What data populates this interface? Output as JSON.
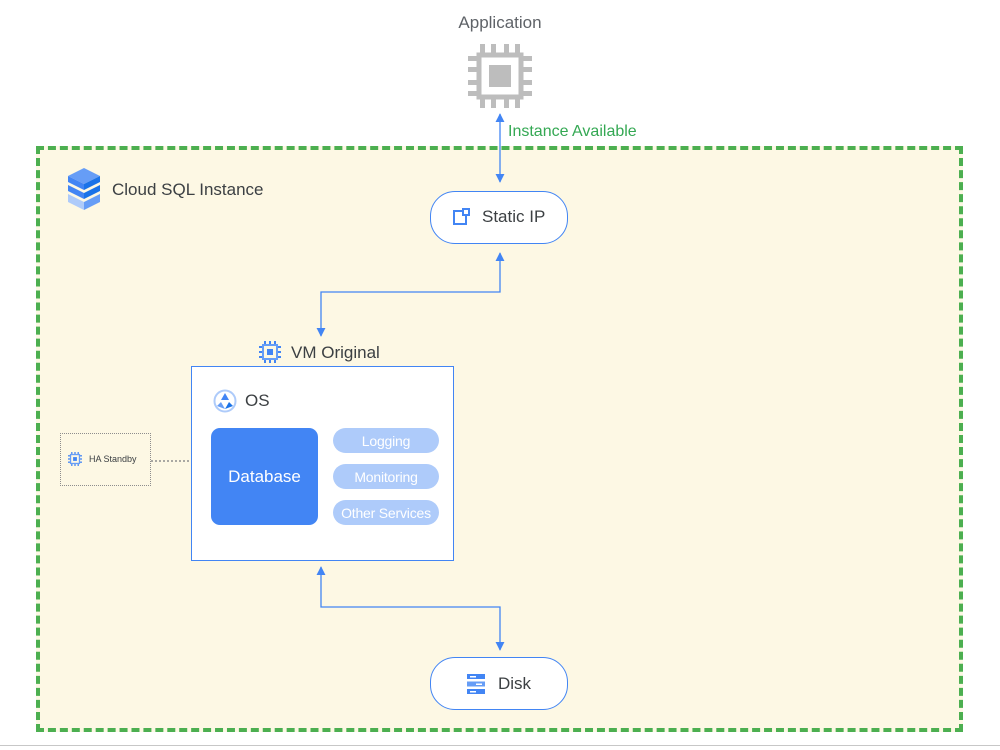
{
  "application": {
    "title": "Application"
  },
  "connection": {
    "label": "Instance Available"
  },
  "cloud_sql": {
    "title": "Cloud SQL Instance"
  },
  "static_ip": {
    "label": "Static IP"
  },
  "vm": {
    "title": "VM Original",
    "os_label": "OS",
    "database_label": "Database",
    "services": [
      "Logging",
      "Monitoring",
      "Other Services"
    ]
  },
  "ha_standby": {
    "label": "HA Standby"
  },
  "disk": {
    "label": "Disk"
  },
  "colors": {
    "accent": "#4285f4",
    "service_pill": "#aecbfa",
    "region_fill": "#fdf8e4",
    "region_border": "#4caf50",
    "available_text": "#34a853",
    "chip_gray": "#bdbdbd"
  }
}
